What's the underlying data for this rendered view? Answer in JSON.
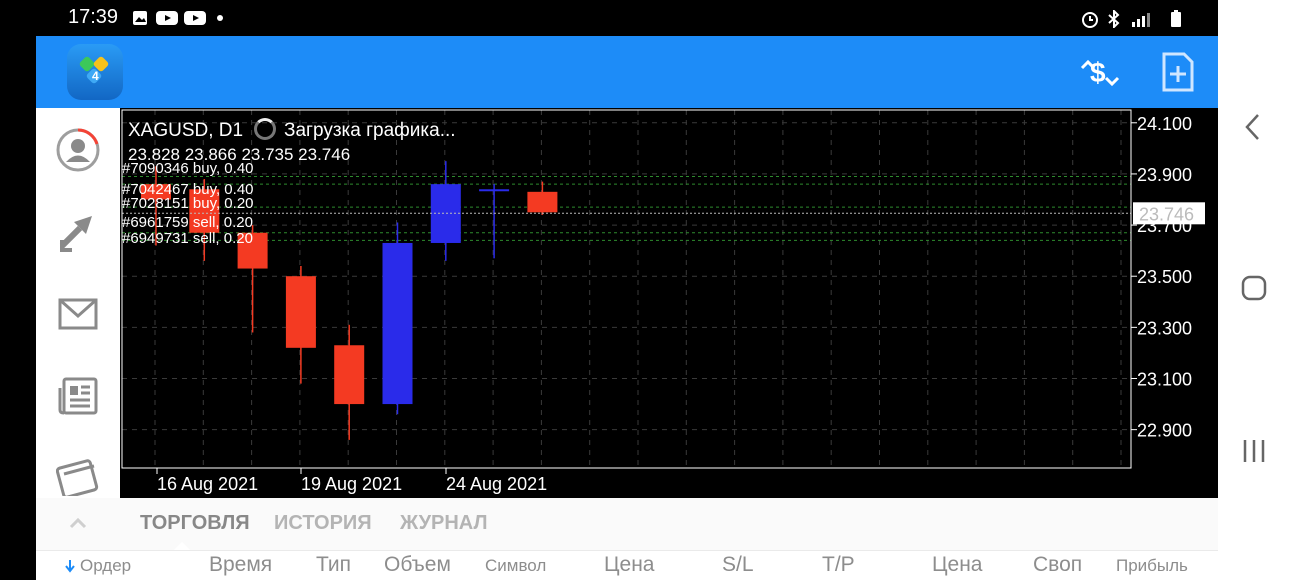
{
  "status_bar": {
    "time": "17:39"
  },
  "chart": {
    "symbol": "XAGUSD, D1",
    "status": "Загрузка графика...",
    "ohlc": "23.828 23.866 23.735 23.746",
    "current_price": "23.746",
    "price_ticks": [
      "24.100",
      "23.900",
      "23.700",
      "23.500",
      "23.300",
      "23.100",
      "22.900"
    ],
    "date_ticks": [
      "16 Aug 2021",
      "19 Aug 2021",
      "24 Aug 2021"
    ],
    "positions": [
      {
        "label": "#7090346 buy, 0.40"
      },
      {
        "label": "#7042467 buy, 0.40"
      },
      {
        "label": "#7028151 buy, 0.20"
      },
      {
        "label": "#6961759 sell, 0.20"
      },
      {
        "label": "#6949731 sell, 0.20"
      }
    ],
    "colors": {
      "bull": "#2a2bea",
      "bear": "#f43a22",
      "grid": "#3a3a3a",
      "level": "#2e8b2e",
      "frame": "#ffffff"
    }
  },
  "chart_data": {
    "type": "candlestick",
    "symbol": "XAGUSD",
    "timeframe": "D1",
    "ylim": [
      22.75,
      24.15
    ],
    "candles": [
      {
        "open": 23.86,
        "high": 23.93,
        "low": 23.62,
        "close": 23.8
      },
      {
        "open": 23.84,
        "high": 23.88,
        "low": 23.56,
        "close": 23.67
      },
      {
        "open": 23.67,
        "high": 23.7,
        "low": 23.28,
        "close": 23.53
      },
      {
        "open": 23.5,
        "high": 23.54,
        "low": 23.08,
        "close": 23.22
      },
      {
        "open": 23.23,
        "high": 23.31,
        "low": 22.86,
        "close": 23.0
      },
      {
        "open": 23.0,
        "high": 23.71,
        "low": 22.96,
        "close": 23.63
      },
      {
        "open": 23.63,
        "high": 23.95,
        "low": 23.56,
        "close": 23.86
      },
      {
        "open": 23.84,
        "high": 23.86,
        "low": 23.57,
        "close": 23.84
      },
      {
        "open": 23.83,
        "high": 23.87,
        "low": 23.74,
        "close": 23.75
      }
    ],
    "position_levels": [
      23.89,
      23.86,
      23.77,
      23.67,
      23.64
    ]
  },
  "bottom_panel": {
    "tabs": [
      "ТОРГОВЛЯ",
      "ИСТОРИЯ",
      "ЖУРНАЛ"
    ],
    "columns": [
      "Ордер",
      "Время",
      "Тип",
      "Объем",
      "Символ",
      "Цена",
      "S/L",
      "T/P",
      "Цена",
      "Своп",
      "Прибыль"
    ]
  },
  "sidebar": {
    "items": [
      "account-icon",
      "trade-arrows-icon",
      "mail-icon",
      "news-icon",
      "calendar-icon"
    ]
  }
}
